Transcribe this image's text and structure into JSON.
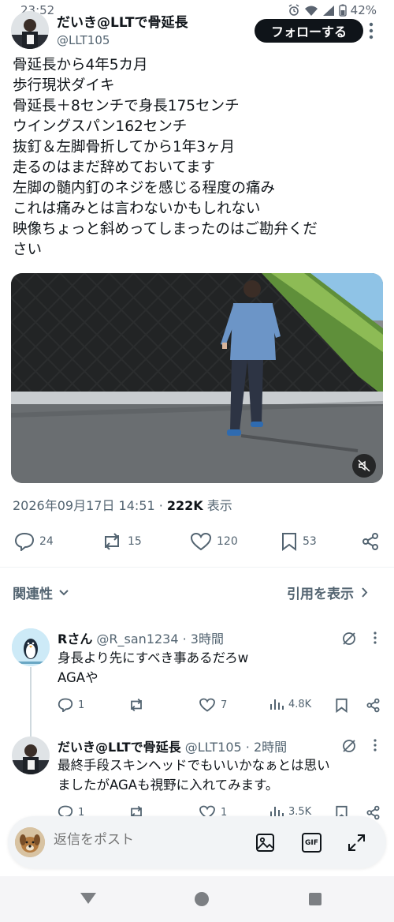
{
  "status_bar": {
    "time": "23:52",
    "battery": "42%"
  },
  "tweet": {
    "display_name": "だいき@LLTで骨延長",
    "handle": "@LLT105",
    "follow_label": "フォローする",
    "lines": [
      "骨延長から4年5カ月",
      "歩行現状ダイキ",
      "骨延長＋8センチで身長175センチ",
      "ウイングスパン162センチ",
      "抜釘＆左脚骨折してから1年3ヶ月",
      "走るのはまだ辞めておいてます",
      "左脚の髄内釘のネジを感じる程度の痛み",
      "これは痛みとは言わないかもしれない",
      "映像ちょっと斜めってしまったのはご勘弁くだ",
      "さい"
    ],
    "timestamp": "2026年09月17日 14:51",
    "views_count": "222K",
    "views_label": "表示",
    "actions": {
      "replies": "24",
      "reposts": "15",
      "likes": "120",
      "bookmarks": "53"
    }
  },
  "relevance": {
    "label": "関連性",
    "quotes_link": "引用を表示"
  },
  "replies": [
    {
      "name": "Rさん",
      "handle_time": "@R_san1234 · 3時間",
      "lines": [
        "身長より先にすべき事あるだろw",
        "AGAや"
      ],
      "replies": "1",
      "reposts": "",
      "likes": "7",
      "views": "4.8K"
    },
    {
      "name": "だいき@LLTで骨延長",
      "handle_time": "@LLT105 · 2時間",
      "lines": [
        "最終手段スキンヘッドでもいいかなぁとは思い",
        "ましたがAGAも視野に入れてみます。"
      ],
      "replies": "1",
      "reposts": "",
      "likes": "1",
      "views": "3.5K"
    }
  ],
  "composer": {
    "placeholder": "返信をポスト",
    "gif_label": "GIF"
  }
}
